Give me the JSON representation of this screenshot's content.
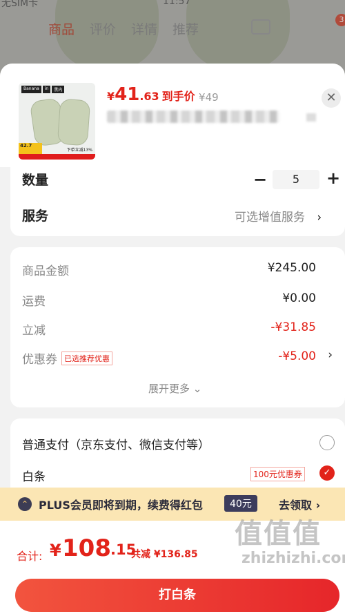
{
  "background": {
    "status_carrier": "无SIM卡",
    "status_time": "11:57",
    "tabs": [
      "商品",
      "评价",
      "详情",
      "推荐"
    ],
    "cart_badge": "3"
  },
  "product": {
    "thumb_brand": [
      "Banana",
      "in",
      "黑内"
    ],
    "thumb_price": "42.7",
    "thumb_tag": "下单立减13%",
    "price_currency": "¥",
    "price_int": "41",
    "price_dec": ".63",
    "price_label": "到手价",
    "original_price": "¥49"
  },
  "quantity": {
    "label": "数量",
    "value": "5"
  },
  "service": {
    "label": "服务",
    "value": "可选增值服务"
  },
  "summary": {
    "rows": [
      {
        "label": "商品金额",
        "value": "¥245.00"
      },
      {
        "label": "运费",
        "value": "¥0.00"
      },
      {
        "label": "立减",
        "value": "-¥31.85"
      },
      {
        "label": "优惠券",
        "tag": "已选推荐优惠",
        "value": "-¥5.00"
      }
    ],
    "expand": "展开更多"
  },
  "payment": {
    "option1": "普通支付（京东支付、微信支付等）",
    "option2": "白条",
    "option2_tag": "100元优惠券"
  },
  "plus_banner": {
    "text": "PLUS会员即将到期，续费得红包",
    "tag": "40元",
    "link": "去领取"
  },
  "footer": {
    "total_label": "合计:",
    "total_currency": "¥",
    "total_int": "108",
    "total_dec": ".15",
    "saved": "共减 ¥136.85",
    "pay_button": "打白条"
  },
  "watermark": {
    "logo": "值值值",
    "url": "zhizhizhi.com"
  }
}
